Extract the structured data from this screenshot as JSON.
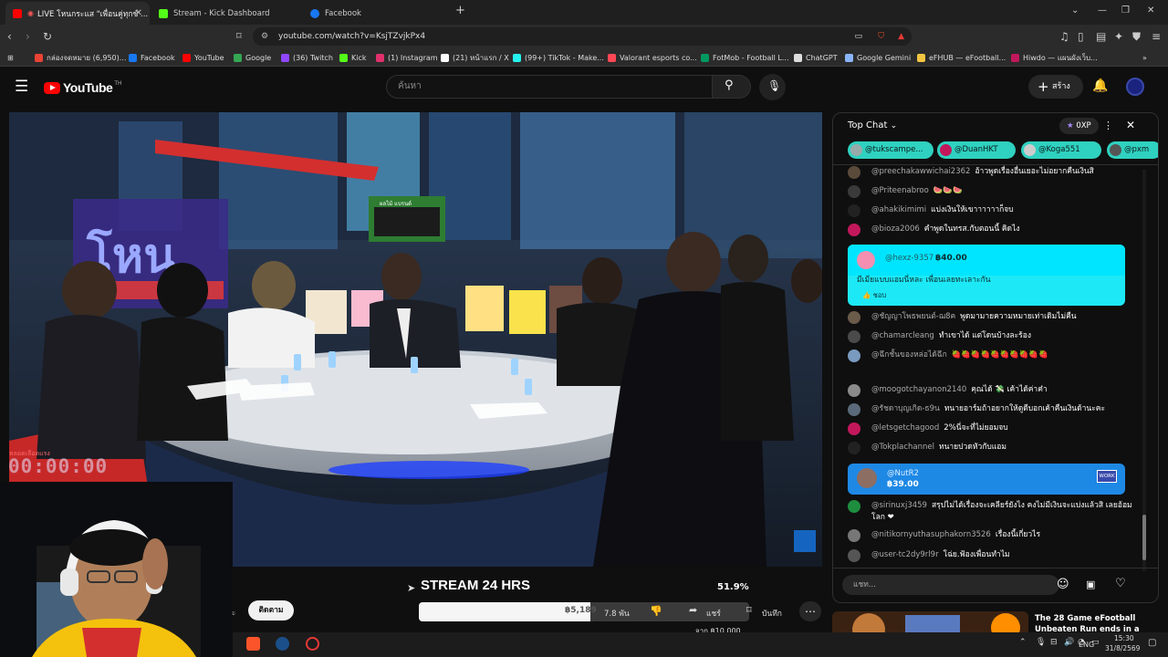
{
  "browser": {
    "tabs": [
      {
        "label": "LIVE โหนกระแส \"เพื่อนคู่ทุกข์ ...",
        "icon": "youtube-icon",
        "active": true
      },
      {
        "label": "Stream - Kick Dashboard",
        "icon": "kick-icon",
        "active": false
      },
      {
        "label": "Facebook",
        "icon": "facebook-icon",
        "active": false
      }
    ],
    "url": "youtube.com/watch?v=KsjTZvjkPx4",
    "bookmarks": [
      {
        "label": "กล่องจดหมาย (6,950)...",
        "color": "#ea4335"
      },
      {
        "label": "Facebook",
        "color": "#1877f2"
      },
      {
        "label": "YouTube",
        "color": "#ff0000"
      },
      {
        "label": "Google",
        "color": "#34a853"
      },
      {
        "label": "(36) Twitch",
        "color": "#9146ff"
      },
      {
        "label": "Kick",
        "color": "#53fc18"
      },
      {
        "label": "(1) Instagram",
        "color": "#e1306c"
      },
      {
        "label": "(21) หน้าแรก / X",
        "color": "#ffffff"
      },
      {
        "label": "(99+) TikTok - Make...",
        "color": "#25f4ee"
      },
      {
        "label": "Valorant esports co...",
        "color": "#ff4655"
      },
      {
        "label": "FotMob - Football L...",
        "color": "#00985f"
      },
      {
        "label": "ChatGPT",
        "color": "#dddddd"
      },
      {
        "label": "Google Gemini",
        "color": "#8ab4f8"
      },
      {
        "label": "eFHUB — eFootball...",
        "color": "#f5c542"
      },
      {
        "label": "Hiwdo — แผนผังเว็บ...",
        "color": "#c2185b"
      }
    ]
  },
  "youtube": {
    "logo": "YouTube",
    "logo_sup": "TH",
    "search_placeholder": "ค้นหา",
    "create_label": "สร้าง"
  },
  "video": {
    "overlay_timer": "00:00:00",
    "overlay_small": "หลอดเลือดแรง",
    "tv_badge": "โหน",
    "screen_text": "ผลไม้ แบรนด์",
    "counter_title": "STREAM 24 HRS",
    "counter_percent": "51.9%",
    "progress_fraction": 0.519,
    "progress_amount": "฿5,189",
    "goal_label": "จาก ฿10,000"
  },
  "actions": {
    "subscribe_label": "ติดตาม",
    "likes_label": "7.8 พัน",
    "share_label": "แชร์",
    "save_label": "บันทึก"
  },
  "chat": {
    "header": "Top Chat",
    "xp": "0XP",
    "chips": [
      "@tukscampe...",
      "@DuanHKT",
      "@Koga551",
      "@pxm"
    ],
    "messages": [
      {
        "author": "@preechakawwichai2362",
        "text": "อ้าวพูดเรื่องอื่นเยอะไม่อยากคืนเงินสิ",
        "color": "#5a4a3a"
      },
      {
        "author": "@Priteenabroo",
        "text": "🍉🍉🍉",
        "color": "#3a3a3a"
      },
      {
        "author": "@ahakikimimi",
        "text": "แบ่งเงินให้เขาาาาาาก็จบ",
        "color": "#222222"
      },
      {
        "author": "@bioza2006",
        "text": "คำพูดในทรส.กับตอนนี้ คิดไง",
        "color": "#c2185b"
      },
      {
        "author": "@ชัญญาโพธพยนต์-ฌ8ค",
        "text": "พูดมามายความหมายเท่าเดิมไม่คืน",
        "color": "#6b5b4b"
      },
      {
        "author": "@chamarcleang",
        "text": "ทำเขาได้ แต่โดนบ้างละร้อง",
        "color": "#4a4a4a"
      },
      {
        "author": "@ฉึกชั้นของหล่อได้ฉึก",
        "text": "🍓🍓🍓🍓🍓🍓🍓🍓🍓🍓",
        "color": "#7a9ac0"
      },
      {
        "author": "@moogotchayanon2140",
        "text": "คุณได้ 💸 เค้าได้ค่าค๋า",
        "color": "#8a8a8a"
      },
      {
        "author": "@รัชดาบุญเกิด-ธ9น",
        "text": "ทนายอาร์มถ้าอยากให้ดูดีบอกเค้าคืนเงินด้านะคะ",
        "color": "#5a6a7a"
      },
      {
        "author": "@letsgetchagood",
        "text": "2%นี่จะที่ไม่ยอมจบ",
        "color": "#c2185b"
      },
      {
        "author": "@Tokplachannel",
        "text": "ทนายปวดหัวกับแอม",
        "color": "#222222"
      },
      {
        "author": "@sirinuxj3459",
        "text": "สรุปไม่ได้เรื่องจะเคลียร์ยังไง คงไม่มีเงินจะแบ่งแล้วสิ เลยอ้อมโลก ❤",
        "color": "#1e8e3e"
      },
      {
        "author": "@nitikornyuthasuphakorn3526",
        "text": "เรื่องนี้เกี่ยวไร",
        "color": "#777777"
      },
      {
        "author": "@user-tc2dy9rl9r",
        "text": "โฉ่ย.ฟ้องเพื่อนทำไม",
        "color": "#555555"
      }
    ],
    "superchats": [
      {
        "author": "@hexz-9357",
        "amount": "฿40.00",
        "text": "มีเมียแบบแอมนี่หละ เพื่อนเลยทะเลาะกัน",
        "reply": "ชอบ",
        "color": "#1de9f6"
      },
      {
        "author": "@NutR2",
        "amount": "฿39.00",
        "color": "#1e88e5"
      }
    ],
    "input_placeholder": "แชท..."
  },
  "recommended": {
    "title": "The 28 Game eFootball Unbeaten Run ends in a"
  },
  "taskbar": {
    "lang": "ENG",
    "time": "15:30",
    "date": "31/8/2569"
  }
}
